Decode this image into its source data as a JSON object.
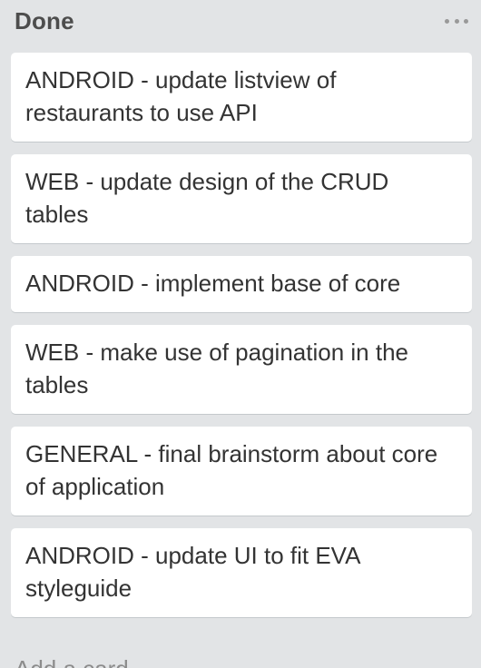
{
  "list": {
    "title": "Done",
    "menu_icon": "ellipsis-icon",
    "cards": [
      {
        "title": "ANDROID - update listview of restaurants to use API"
      },
      {
        "title": "WEB - update design of the CRUD tables"
      },
      {
        "title": "ANDROID - implement base of core"
      },
      {
        "title": "WEB - make use of pagination in the tables"
      },
      {
        "title": "GENERAL - final brainstorm about core of application"
      },
      {
        "title": "ANDROID - update UI to fit EVA styleguide"
      }
    ],
    "add_card_label": "Add a card"
  },
  "colors": {
    "list_background": "#e2e4e6",
    "card_background": "#ffffff",
    "title_text": "#4d4d4d",
    "card_text": "#333333",
    "muted_text": "#8c8c8c"
  }
}
